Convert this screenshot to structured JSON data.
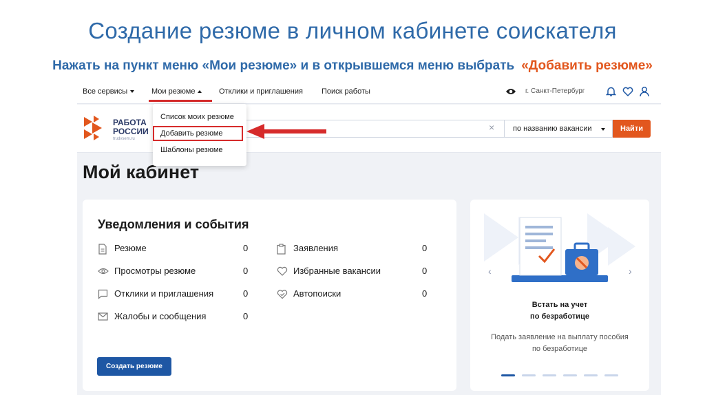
{
  "slide": {
    "title": "Создание резюме в личном кабинете соискателя",
    "subtitle": "Нажать на пункт меню «Мои резюме» и в открывшемся меню выбрать",
    "subtitle_highlight": "«Добавить резюме»"
  },
  "topbar": {
    "all_services": "Все сервисы",
    "my_resumes": "Мои резюме",
    "responses": "Отклики и приглашения",
    "job_search": "Поиск работы",
    "city": "г. Санкт-Петербург"
  },
  "dropdown": {
    "items": [
      "Список моих резюме",
      "Добавить резюме",
      "Шаблоны резюме"
    ]
  },
  "header": {
    "logo_line1": "РАБОТА",
    "logo_line2": "РОССИИ",
    "logo_small": "trudvsem.ru",
    "search_type": "по названию вакансии",
    "find_label": "Найти",
    "clear_symbol": "×"
  },
  "page_title": "Мой кабинет",
  "notifications": {
    "title": "Уведомления и события",
    "left": [
      {
        "label": "Резюме",
        "count": "0",
        "icon": "document-icon"
      },
      {
        "label": "Просмотры резюме",
        "count": "0",
        "icon": "eye-icon"
      },
      {
        "label": "Отклики и приглашения",
        "count": "0",
        "icon": "chat-icon"
      },
      {
        "label": "Жалобы и сообщения",
        "count": "0",
        "icon": "mail-icon"
      }
    ],
    "right": [
      {
        "label": "Заявления",
        "count": "0",
        "icon": "clipboard-icon"
      },
      {
        "label": "Избранные вакансии",
        "count": "0",
        "icon": "heart-icon"
      },
      {
        "label": "Автопоиски",
        "count": "0",
        "icon": "autosearch-icon"
      }
    ],
    "create_button": "Создать резюме"
  },
  "promo": {
    "title_line1": "Встать на учет",
    "title_line2": "по безработице",
    "desc_line1": "Подать заявление на выплату пособия",
    "desc_line2": "по безработице",
    "prev_symbol": "‹",
    "next_symbol": "›",
    "active_slide": 1,
    "total_slides": 6
  },
  "colors": {
    "slide_text": "#2f6aa9",
    "highlight": "#e2571e",
    "primary_button": "#1e57a4",
    "find_button": "#e2571e",
    "alert_red": "#d62b2b"
  }
}
